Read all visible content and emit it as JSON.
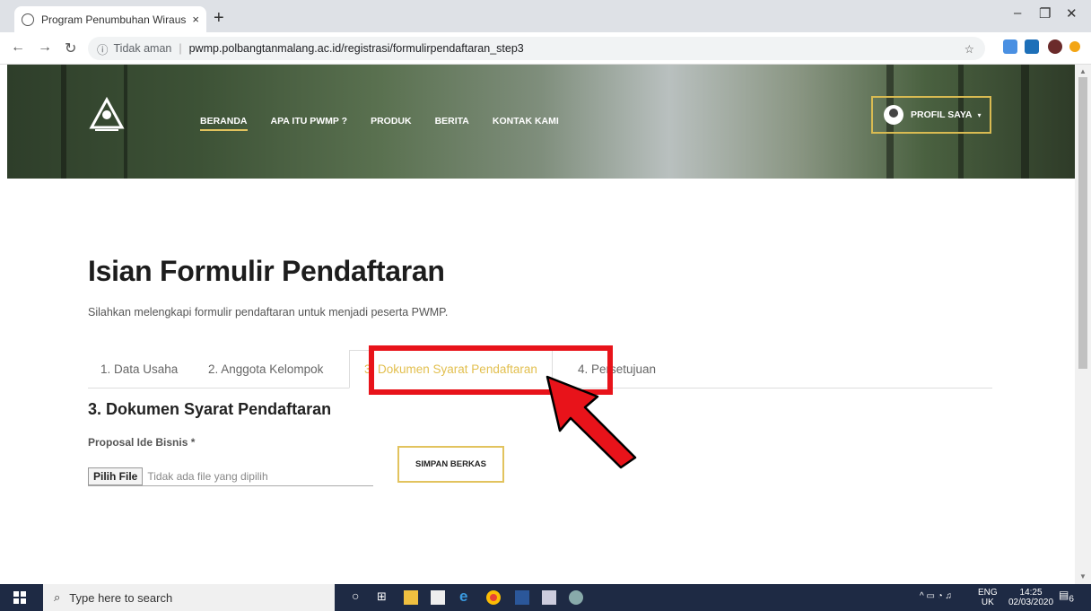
{
  "browser": {
    "tab_title": "Program Penumbuhan Wirausaha",
    "tab_close": "×",
    "new_tab": "+",
    "minimize": "–",
    "restore": "❐",
    "close": "✕",
    "security_label": "Tidak aman",
    "url": "pwmp.polbangtanmalang.ac.id/registrasi/formulirpendaftaran_step3"
  },
  "nav": {
    "items": [
      {
        "label": "BERANDA",
        "active": true
      },
      {
        "label": "APA ITU PWMP ?"
      },
      {
        "label": "PRODUK"
      },
      {
        "label": "BERITA"
      },
      {
        "label": "KONTAK KAMI"
      }
    ],
    "profile": "PROFIL SAYA"
  },
  "page": {
    "title": "Isian Formulir Pendaftaran",
    "subtitle": "Silahkan melengkapi formulir pendaftaran untuk menjadi peserta PWMP.",
    "steps": [
      {
        "label": "1. Data Usaha"
      },
      {
        "label": "2. Anggota Kelompok"
      },
      {
        "label": "3. Dokumen Syarat Pendaftaran",
        "active": true
      },
      {
        "label": "4. Persetujuan"
      }
    ],
    "section_title": "3. Dokumen Syarat Pendaftaran",
    "field_label": "Proposal Ide Bisnis *",
    "file_button": "Pilih File",
    "file_status": "Tidak ada file yang dipilih",
    "save_button": "SIMPAN BERKAS"
  },
  "taskbar": {
    "search_placeholder": "Type here to search",
    "lang1": "ENG",
    "lang2": "UK",
    "time": "14:25",
    "date": "02/03/2020",
    "notif_count": "6"
  },
  "colors": {
    "accent": "#e2c35e",
    "highlight": "#e8131a"
  }
}
